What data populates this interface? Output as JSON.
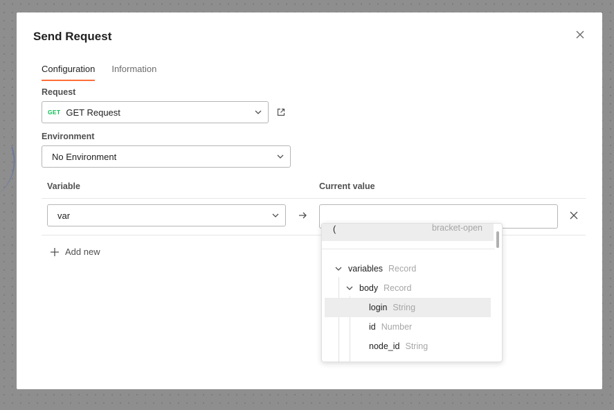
{
  "modal": {
    "title": "Send Request",
    "tabs": [
      {
        "label": "Configuration",
        "active": true
      },
      {
        "label": "Information",
        "active": false
      }
    ]
  },
  "request": {
    "label": "Request",
    "method": "GET",
    "value": "GET Request",
    "method_color": "#0cbb52"
  },
  "environment": {
    "label": "Environment",
    "value": "No Environment"
  },
  "variables_table": {
    "col_variable": "Variable",
    "col_value": "Current value",
    "rows": [
      {
        "variable": "var",
        "value": ""
      }
    ],
    "add_new": "Add new"
  },
  "autocomplete": {
    "top_item": {
      "symbol": "(",
      "description": "bracket-open"
    },
    "tree": [
      {
        "name": "variables",
        "type": "Record",
        "expanded": true
      },
      {
        "name": "body",
        "type": "Record",
        "expanded": true
      },
      {
        "name": "login",
        "type": "String",
        "highlighted": true
      },
      {
        "name": "id",
        "type": "Number"
      },
      {
        "name": "node_id",
        "type": "String"
      }
    ]
  },
  "colors": {
    "accent": "#ff6c37",
    "backdrop": "#8e8e8e"
  }
}
